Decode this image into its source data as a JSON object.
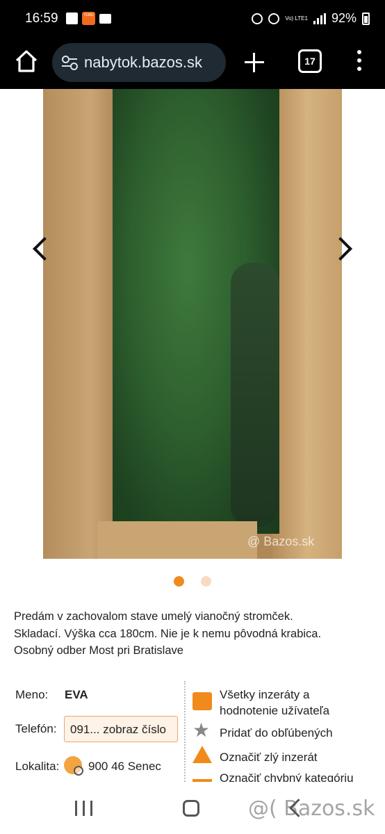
{
  "status_bar": {
    "time": "16:59",
    "temu_label": "TEMU",
    "network": "Vo) LTE1",
    "battery": "92%"
  },
  "browser": {
    "url": "nabytok.bazos.sk",
    "tab_count": "17"
  },
  "gallery": {
    "watermark": "@ Bazos.sk",
    "dots_total": 2,
    "active_dot": 1,
    "colors": {
      "active_dot": "#f08a1c",
      "inactive_dot": "#f9d9c0"
    }
  },
  "description": [
    "Predám v zachovalom stave umelý vianočný stromček.",
    "Skladací. Výška cca 180cm. Nie je k nemu pôvodná krabica.",
    "Osobný odber Most pri Bratislave"
  ],
  "seller": {
    "name_label": "Meno:",
    "name_value": "EVA",
    "phone_label": "Telefón:",
    "phone_button": "091... zobraz číslo",
    "location_label": "Lokalita:",
    "location_value": "900 46 Senec"
  },
  "actions": {
    "all_ads_line1": "Všetky inzeráty a",
    "all_ads_line2": "hodnotenie užívateľa",
    "favorite": "Pridať do obľúbených",
    "report_bad": "Označiť zlý inzerát",
    "report_category": "Označiť chybný kategóriu"
  },
  "bottom_nav": {
    "watermark": "@( Bazos.sk"
  }
}
